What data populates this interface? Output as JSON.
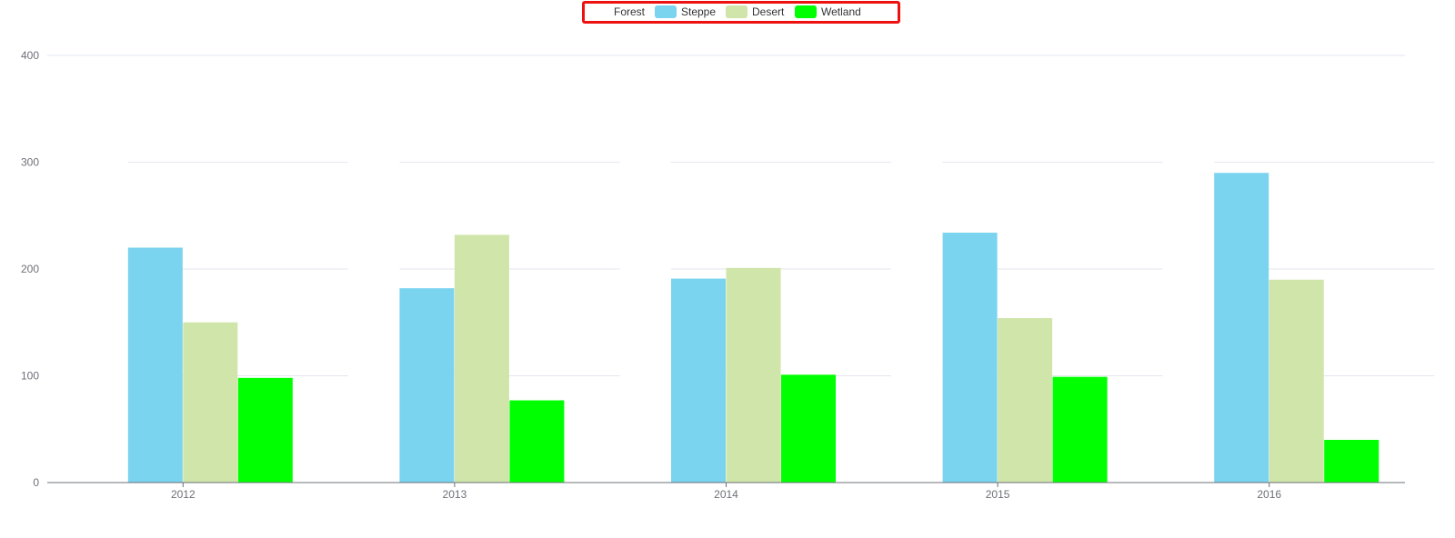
{
  "chart_data": {
    "type": "bar",
    "categories": [
      "2012",
      "2013",
      "2014",
      "2015",
      "2016"
    ],
    "series": [
      {
        "name": "Forest",
        "values": [
          null,
          null,
          null,
          null,
          null
        ],
        "color": "#4a6ee0",
        "hidden": true
      },
      {
        "name": "Steppe",
        "values": [
          220,
          182,
          191,
          234,
          290
        ],
        "color": "#7ad3ef"
      },
      {
        "name": "Desert",
        "values": [
          150,
          232,
          201,
          154,
          190
        ],
        "color": "#cfe5aa"
      },
      {
        "name": "Wetland",
        "values": [
          98,
          77,
          101,
          99,
          40
        ],
        "color": "#00ff00"
      }
    ],
    "ylim": [
      0,
      400
    ],
    "yticks": [
      0,
      100,
      200,
      300,
      400
    ],
    "grid": true,
    "legend_position": "top-center",
    "legend_highlight_color": "#ee1111"
  }
}
